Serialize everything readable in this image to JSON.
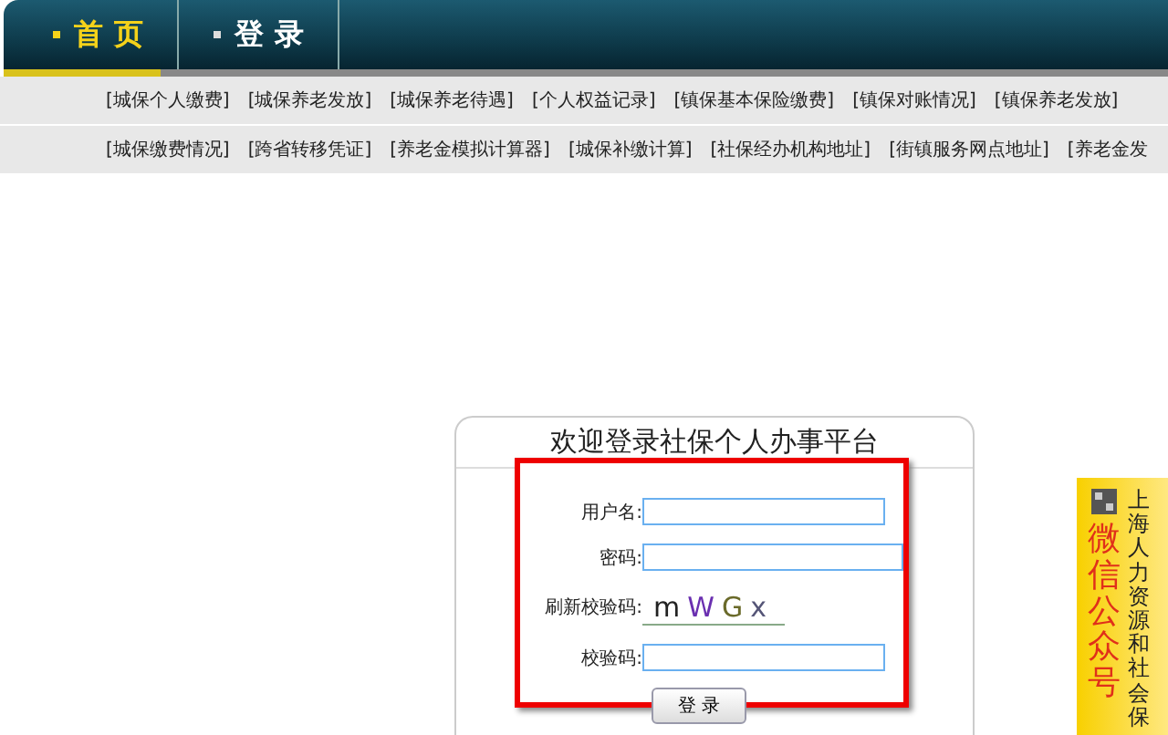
{
  "tabs": [
    {
      "label": "首 页",
      "selected": true
    },
    {
      "label": "登 录",
      "selected": false
    }
  ],
  "nav_rows": [
    [
      "[城保个人缴费]",
      "[城保养老发放]",
      "[城保养老待遇]",
      "[个人权益记录]",
      "[镇保基本保险缴费]",
      "[镇保对账情况]",
      "[镇保养老发放]"
    ],
    [
      "[城保缴费情况]",
      "[跨省转移凭证]",
      "[养老金模拟计算器]",
      "[城保补缴计算]",
      "[社保经办机构地址]",
      "[街镇服务网点地址]",
      "[养老金发"
    ]
  ],
  "login": {
    "title": "欢迎登录社保个人办事平台",
    "fields": [
      {
        "kind": "input",
        "label": "用户名:",
        "wide": false
      },
      {
        "kind": "input",
        "label": "密码:",
        "wide": true
      },
      {
        "kind": "captcha",
        "label": "刷新校验码:",
        "captcha": [
          "m",
          "W",
          "G",
          "x"
        ]
      },
      {
        "kind": "input",
        "label": "校验码:",
        "wide": false
      }
    ],
    "button": "登 录"
  },
  "banner": {
    "subtitle": "上海人力资源和社会保",
    "title": "微信公众号"
  }
}
